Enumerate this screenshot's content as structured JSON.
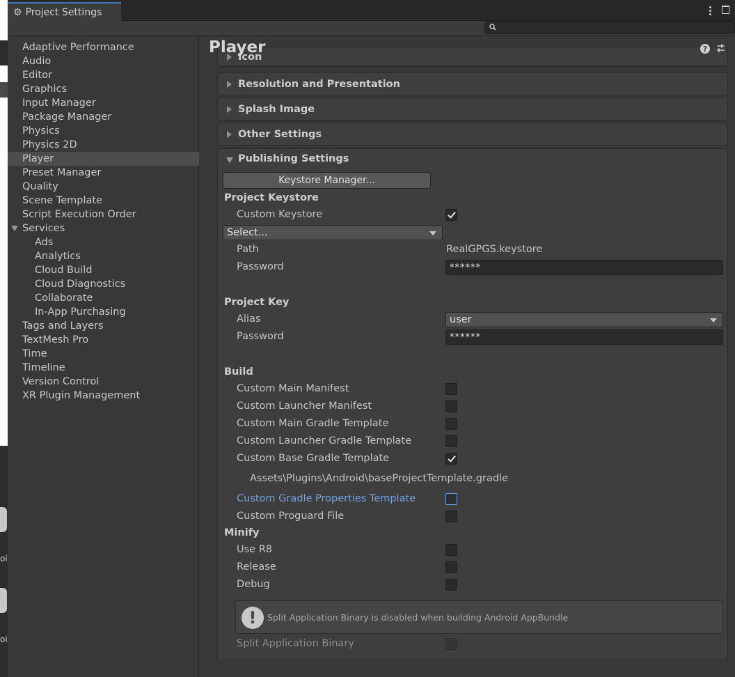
{
  "window": {
    "tab_title": "Project Settings",
    "search_placeholder": ""
  },
  "left_strip": {
    "label_1": "oi",
    "label_2": "oi"
  },
  "sidebar": {
    "items": [
      {
        "label": "Adaptive Performance"
      },
      {
        "label": "Audio"
      },
      {
        "label": "Editor"
      },
      {
        "label": "Graphics"
      },
      {
        "label": "Input Manager"
      },
      {
        "label": "Package Manager"
      },
      {
        "label": "Physics"
      },
      {
        "label": "Physics 2D"
      },
      {
        "label": "Player",
        "selected": true
      },
      {
        "label": "Preset Manager"
      },
      {
        "label": "Quality"
      },
      {
        "label": "Scene Template"
      },
      {
        "label": "Script Execution Order"
      },
      {
        "label": "Services",
        "expanded": true
      },
      {
        "label": "Ads",
        "level": 1
      },
      {
        "label": "Analytics",
        "level": 1
      },
      {
        "label": "Cloud Build",
        "level": 1
      },
      {
        "label": "Cloud Diagnostics",
        "level": 1
      },
      {
        "label": "Collaborate",
        "level": 1
      },
      {
        "label": "In-App Purchasing",
        "level": 1
      },
      {
        "label": "Tags and Layers"
      },
      {
        "label": "TextMesh Pro"
      },
      {
        "label": "Time"
      },
      {
        "label": "Timeline"
      },
      {
        "label": "Version Control"
      },
      {
        "label": "XR Plugin Management"
      }
    ]
  },
  "content": {
    "title": "Player",
    "sections": {
      "icon": "Icon",
      "resolution": "Resolution and Presentation",
      "splash": "Splash Image",
      "other": "Other Settings",
      "publishing": "Publishing Settings"
    },
    "publishing": {
      "keystore_manager_button": "Keystore Manager...",
      "project_keystore_heading": "Project Keystore",
      "custom_keystore_label": "Custom Keystore",
      "custom_keystore_checked": true,
      "keystore_select": "Select...",
      "path_label": "Path",
      "path_value": "RealGPGS.keystore",
      "keystore_password_label": "Password",
      "keystore_password_value": "******",
      "project_key_heading": "Project Key",
      "alias_label": "Alias",
      "alias_value": "user",
      "key_password_label": "Password",
      "key_password_value": "******",
      "build_heading": "Build",
      "build_options": [
        {
          "label": "Custom Main Manifest",
          "checked": false
        },
        {
          "label": "Custom Launcher Manifest",
          "checked": false
        },
        {
          "label": "Custom Main Gradle Template",
          "checked": false
        },
        {
          "label": "Custom Launcher Gradle Template",
          "checked": false
        },
        {
          "label": "Custom Base Gradle Template",
          "checked": true
        }
      ],
      "base_gradle_path": "Assets\\Plugins\\Android\\baseProjectTemplate.gradle",
      "gradle_properties_label": "Custom Gradle Properties Template",
      "proguard_label": "Custom Proguard File",
      "minify_heading": "Minify",
      "minify_options": [
        {
          "label": "Use R8",
          "checked": false
        },
        {
          "label": "Release",
          "checked": false
        },
        {
          "label": "Debug",
          "checked": false
        }
      ],
      "split_help_text": "Split Application Binary is disabled when building Android AppBundle",
      "split_binary_label": "Split Application Binary"
    }
  },
  "colors": {
    "background": "#383838",
    "highlight_label": "#6fa3e6",
    "tab_accent": "#3a79bb"
  }
}
